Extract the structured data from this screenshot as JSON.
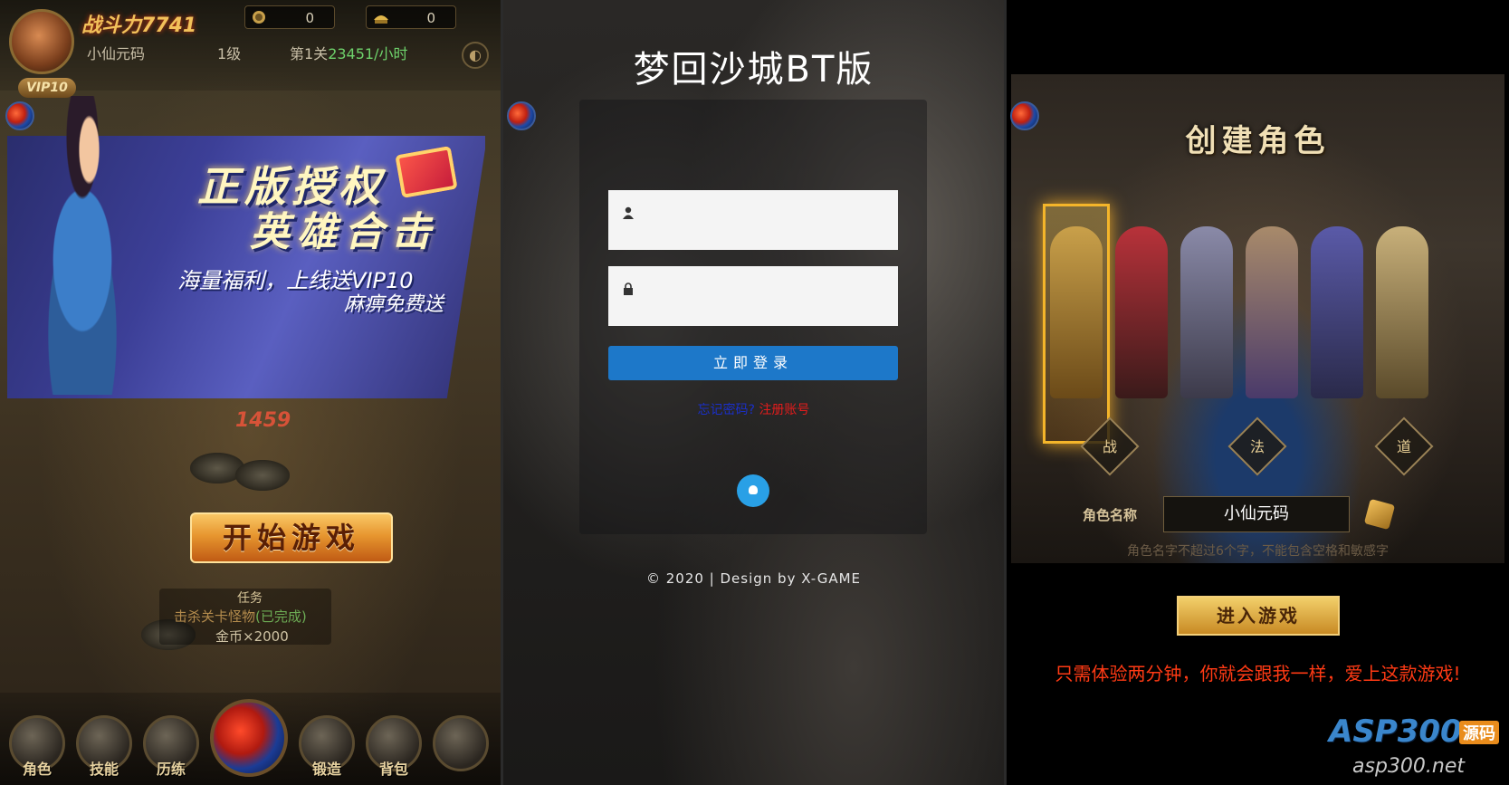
{
  "lobby": {
    "power": "战斗力7741",
    "resource_1": "0",
    "resource_2": "0",
    "nickname": "小仙元码",
    "level": "1级",
    "stage_prefix": "第1关",
    "stage_rate": "23451/小时",
    "vip": "VIP10",
    "banner": {
      "title_1": "正版授权",
      "title_2": "英雄合击",
      "sub_1": "海量福利，上线送VIP10",
      "sub_2": "麻痹免费送"
    },
    "damage": "1459",
    "start_button": "开始游戏",
    "task": {
      "title": "任务",
      "desc": "击杀关卡怪物",
      "status": "(已完成)",
      "reward": "金币×2000"
    },
    "bottom_buttons": [
      "角色",
      "技能",
      "历练",
      "锻造",
      "背包"
    ]
  },
  "login": {
    "title": "梦回沙城BT版",
    "username_icon": "user-icon",
    "password_icon": "lock-icon",
    "login_button": "立即登录",
    "forgot_link": "忘记密码?",
    "register_link": "注册账号",
    "footer": "© 2020 | Design by X-GAME",
    "accent": "#1d78c9"
  },
  "create_role": {
    "title": "创建角色",
    "classes": [
      "战",
      "法",
      "道"
    ],
    "name_label": "角色名称",
    "name_value": "小仙元码",
    "hint": "角色名字不超过6个字，不能包含空格和敏感字",
    "enter_button": "进入游戏",
    "slogan": "只需体验两分钟，你就会跟我一样，爱上这款游戏!"
  },
  "watermark": {
    "brand": "ASP300",
    "tag": "源码",
    "url": "asp300.net"
  }
}
